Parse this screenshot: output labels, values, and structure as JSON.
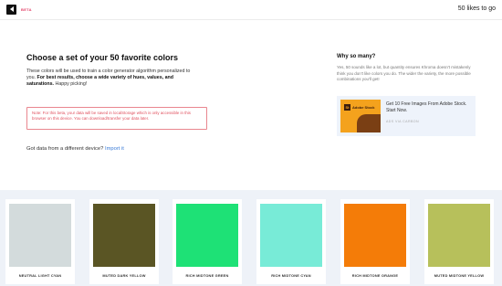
{
  "header": {
    "beta_label": "BETA",
    "likes_text": "50 likes to go"
  },
  "main": {
    "title": "Choose a set of your 50 favorite colors",
    "description_plain": "These colors will be used to train a color generator algorithm personalized to you. ",
    "description_bold": "For best results, choose a wide variety of hues, values, and saturations.",
    "description_tail": " Happy picking!",
    "note": "Note: For this beta, your data will be saved in localStorage which is only accessible in this browser on this device. You can download/transfer your data later.",
    "other_device_text": "Got data from a different device?",
    "import_link": "Import it"
  },
  "aside": {
    "title": "Why so many?",
    "text": "Yes, 50 sounds like a lot, but quantity ensures Khroma doesn't mistakenly think you don't like colors you do. The wider the variety, the more possible combinations you'll get!",
    "ad": {
      "brand": "Adobe Stock",
      "logo_letters": "St",
      "text": "Get 10 Free Images From Adobe Stock. Start Now.",
      "via": "ADS VIA CARBON"
    }
  },
  "colors": [
    {
      "label": "NEUTRAL LIGHT CYAN",
      "hex": "#d3dbdc"
    },
    {
      "label": "MUTED DARK YELLOW",
      "hex": "#5a5524"
    },
    {
      "label": "RICH MIDTONE GREEN",
      "hex": "#1ee176"
    },
    {
      "label": "RICH MIDTONE CYAN",
      "hex": "#78ebd7"
    },
    {
      "label": "RICH MIDTONE ORANGE",
      "hex": "#f47c08"
    },
    {
      "label": "MUTED MIDTONE YELLOW",
      "hex": "#b7c05b"
    }
  ],
  "icons": {
    "logo": "khroma-logo-icon"
  }
}
